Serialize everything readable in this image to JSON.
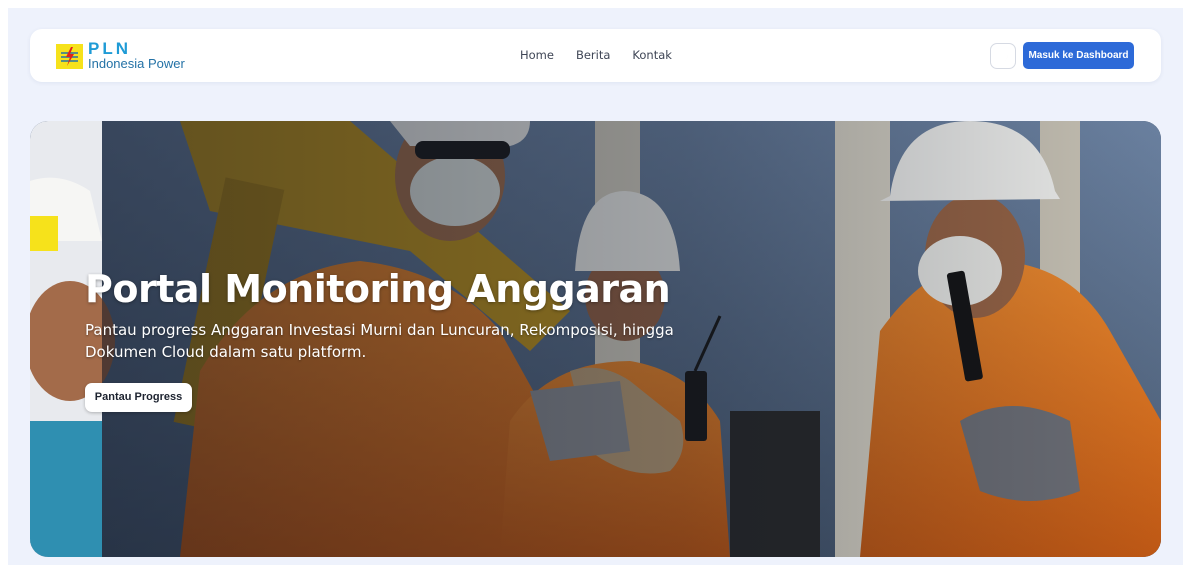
{
  "brand": {
    "name": "PLN",
    "subtitle": "Indonesia Power",
    "logo_color": "#f6e21b",
    "name_color": "#1f9bd6"
  },
  "nav": {
    "links": [
      {
        "label": "Home"
      },
      {
        "label": "Berita"
      },
      {
        "label": "Kontak"
      }
    ],
    "theme_toggle_icon": "moon-icon",
    "dashboard_button": "Masuk ke Dashboard",
    "accent": "#2d6ad8"
  },
  "hero": {
    "title": "Portal Monitoring Anggaran",
    "description": "Pantau progress Anggaran Investasi Murni dan Luncuran, Rekomposisi, hingga Dokumen Cloud dalam satu platform.",
    "button": "Pantau Progress",
    "image": "Petugas PLN Indonesia Power berseragam oranye dengan helm putih di lokasi pembangkit"
  }
}
